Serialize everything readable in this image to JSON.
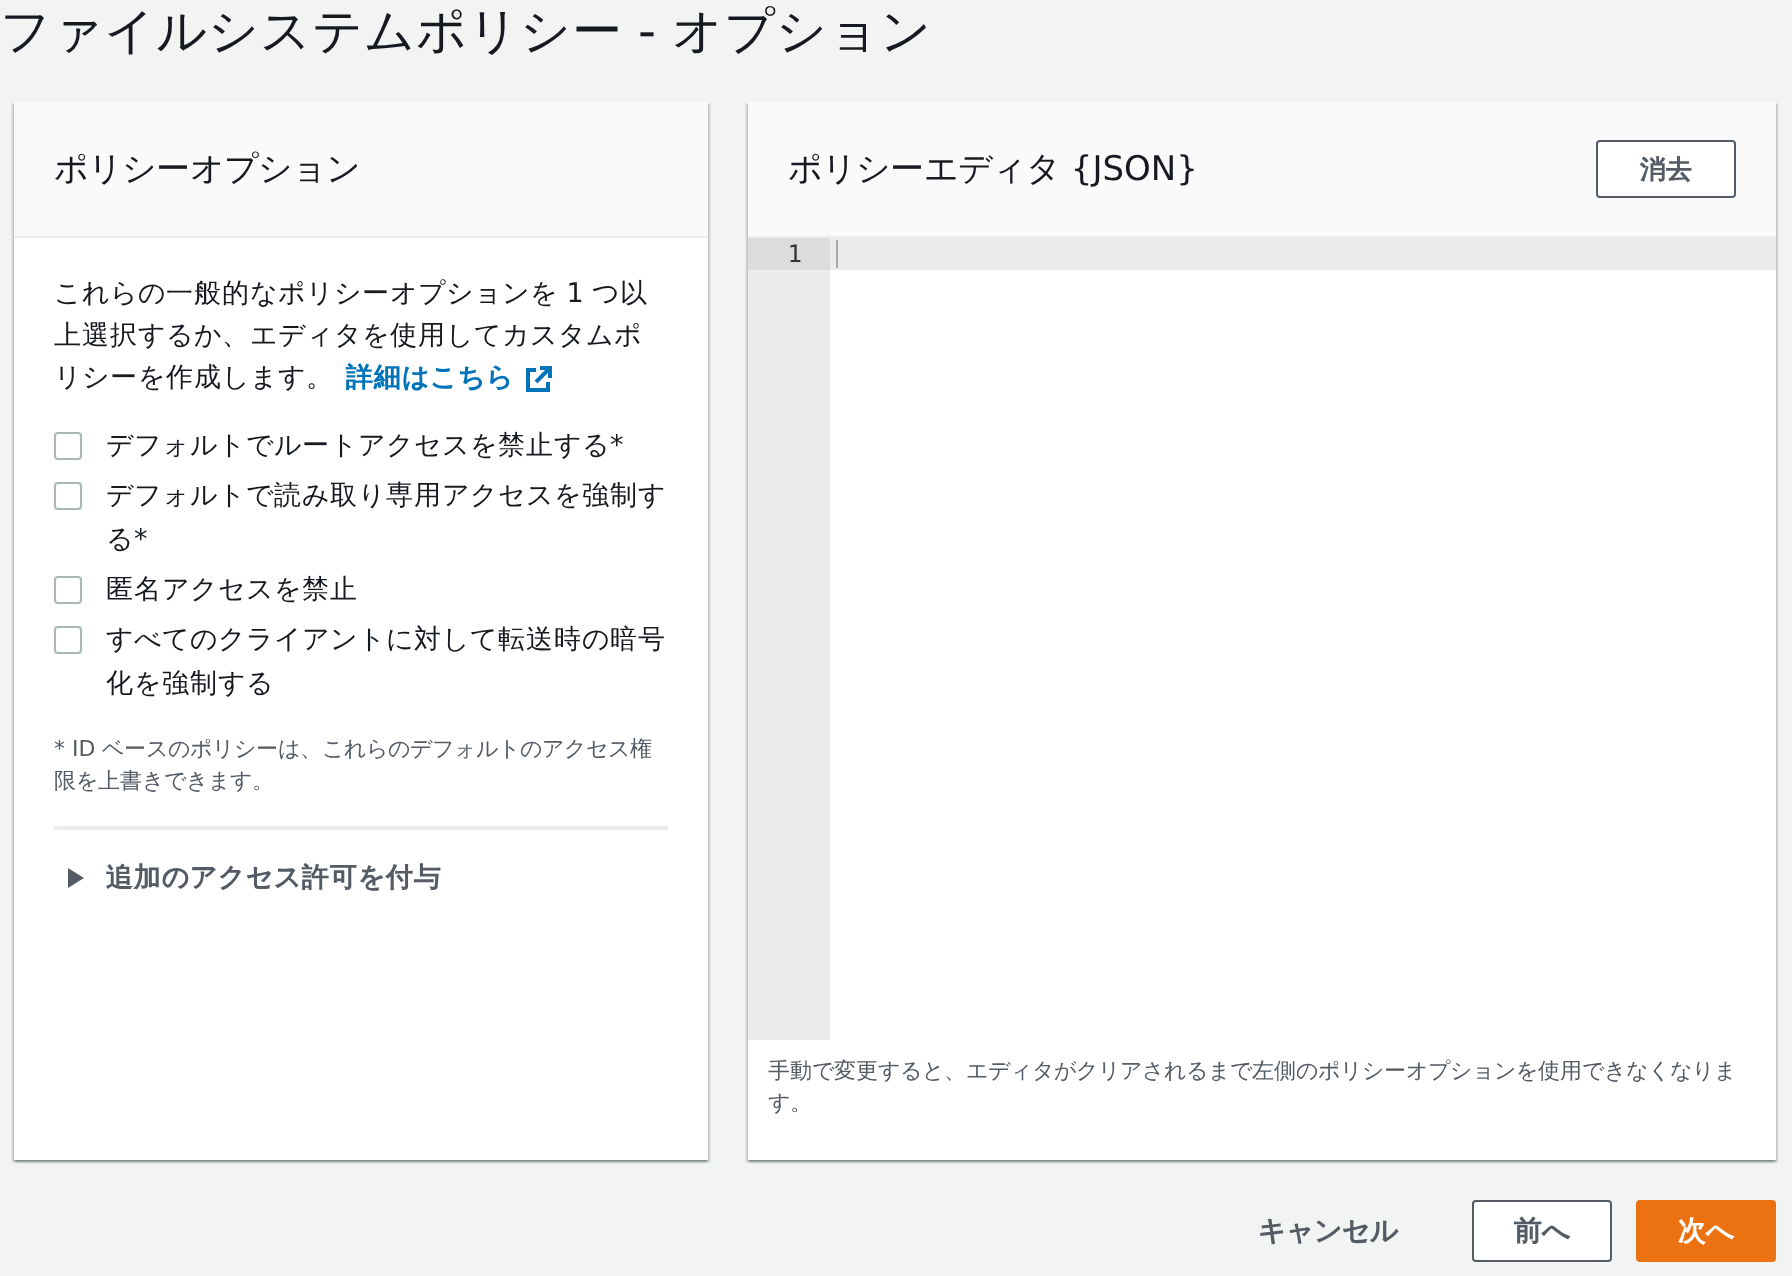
{
  "page_title": "ファイルシステムポリシー - オプション",
  "policy_options": {
    "title": "ポリシーオプション",
    "description": "これらの一般的なポリシーオプションを 1 つ以上選択するか、エディタを使用してカスタムポリシーを作成します。",
    "learn_more_link": "詳細はこちら",
    "options": [
      {
        "label": "デフォルトでルートアクセスを禁止する*",
        "checked": false
      },
      {
        "label": "デフォルトで読み取り専用アクセスを強制する*",
        "checked": false
      },
      {
        "label": "匿名アクセスを禁止",
        "checked": false
      },
      {
        "label": "すべてのクライアントに対して転送時の暗号化を強制する",
        "checked": false
      }
    ],
    "footnote": "* ID ベースのポリシーは、これらのデフォルトのアクセス権限を上書きできます。",
    "additional_permissions": {
      "label": "追加のアクセス許可を付与",
      "expanded": false
    }
  },
  "policy_editor": {
    "title": "ポリシーエディタ {JSON}",
    "clear_button": "消去",
    "line_numbers": [
      "1"
    ],
    "note": "手動で変更すると、エディタがクリアされるまで左側のポリシーオプションを使用できなくなります。"
  },
  "footer_buttons": [
    {
      "label": "キャンセル",
      "kind": "link"
    },
    {
      "label": "前へ",
      "kind": "secondary"
    },
    {
      "label": "次へ",
      "kind": "primary"
    }
  ]
}
